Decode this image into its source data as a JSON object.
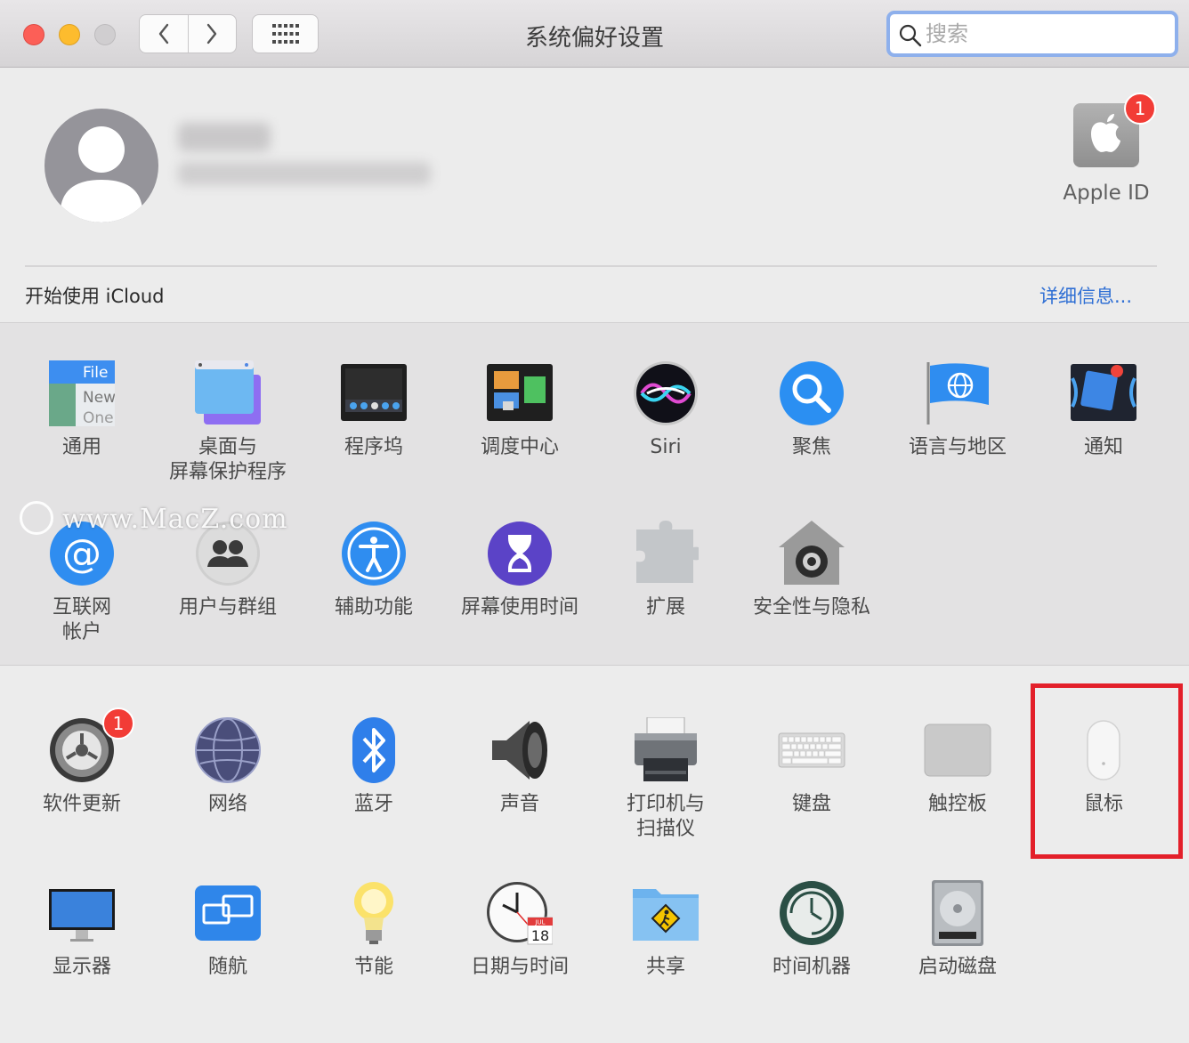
{
  "window": {
    "title": "系统偏好设置",
    "search_placeholder": "搜索"
  },
  "account": {
    "apple_id_label": "Apple ID",
    "apple_id_badge": "1"
  },
  "icloud": {
    "prompt": "开始使用 iCloud",
    "details_link": "详细信息..."
  },
  "panes_row1": [
    {
      "label": "通用",
      "icon": "general-icon"
    },
    {
      "label": "桌面与\n屏幕保护程序",
      "icon": "desktop-screensaver-icon"
    },
    {
      "label": "程序坞",
      "icon": "dock-icon"
    },
    {
      "label": "调度中心",
      "icon": "mission-control-icon"
    },
    {
      "label": "Siri",
      "icon": "siri-icon"
    },
    {
      "label": "聚焦",
      "icon": "spotlight-icon"
    },
    {
      "label": "语言与地区",
      "icon": "language-region-icon"
    },
    {
      "label": "通知",
      "icon": "notifications-icon"
    }
  ],
  "panes_row2": [
    {
      "label": "互联网\n帐户",
      "icon": "internet-accounts-icon"
    },
    {
      "label": "用户与群组",
      "icon": "users-groups-icon"
    },
    {
      "label": "辅助功能",
      "icon": "accessibility-icon"
    },
    {
      "label": "屏幕使用时间",
      "icon": "screen-time-icon"
    },
    {
      "label": "扩展",
      "icon": "extensions-icon"
    },
    {
      "label": "安全性与隐私",
      "icon": "security-privacy-icon"
    }
  ],
  "panes_row3": [
    {
      "label": "软件更新",
      "icon": "software-update-icon",
      "badge": "1"
    },
    {
      "label": "网络",
      "icon": "network-icon"
    },
    {
      "label": "蓝牙",
      "icon": "bluetooth-icon"
    },
    {
      "label": "声音",
      "icon": "sound-icon"
    },
    {
      "label": "打印机与\n扫描仪",
      "icon": "printers-scanners-icon"
    },
    {
      "label": "键盘",
      "icon": "keyboard-icon"
    },
    {
      "label": "触控板",
      "icon": "trackpad-icon"
    },
    {
      "label": "鼠标",
      "icon": "mouse-icon",
      "highlighted": true
    }
  ],
  "panes_row4": [
    {
      "label": "显示器",
      "icon": "displays-icon"
    },
    {
      "label": "随航",
      "icon": "sidecar-icon"
    },
    {
      "label": "节能",
      "icon": "energy-saver-icon"
    },
    {
      "label": "日期与时间",
      "icon": "date-time-icon"
    },
    {
      "label": "共享",
      "icon": "sharing-icon"
    },
    {
      "label": "时间机器",
      "icon": "time-machine-icon"
    },
    {
      "label": "启动磁盘",
      "icon": "startup-disk-icon"
    }
  ],
  "general_icon_text": {
    "line1": "File",
    "line2": "New",
    "line3": "One"
  },
  "calendar_icon_text": {
    "month": "JUL",
    "day": "18"
  },
  "watermark": "www.MacZ.com",
  "colors": {
    "highlight_border": "#e3202a",
    "link": "#2f6fd4",
    "badge": "#f23c36"
  }
}
